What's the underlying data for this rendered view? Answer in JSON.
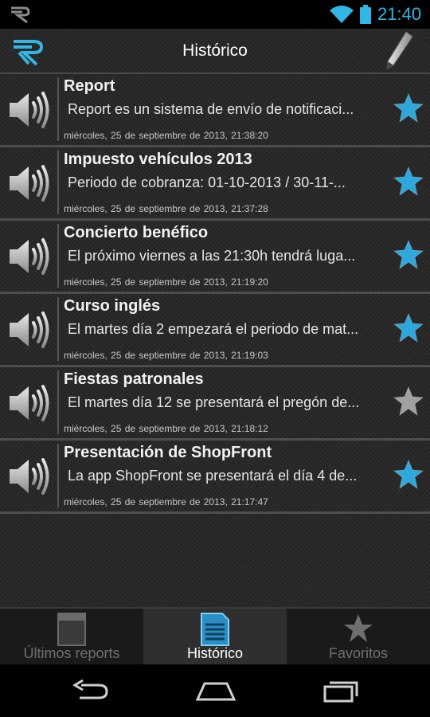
{
  "status_bar": {
    "time": "21:40"
  },
  "action_bar": {
    "title": "Histórico"
  },
  "colors": {
    "accent": "#33b5e5",
    "star_favorite": "#2ea7dd",
    "star_plain": "#a0a0a0"
  },
  "items": [
    {
      "title": "Report",
      "body": "Report es un sistema de envío de notificaci...",
      "date": "miércoles,  25 de septiembre de 2013, 21:38:20",
      "favorite": true
    },
    {
      "title": "Impuesto vehículos 2013",
      "body": "Periodo de cobranza:  01-10-2013 / 30-11-...",
      "date": "miércoles,  25 de septiembre de 2013, 21:37:28",
      "favorite": true
    },
    {
      "title": "Concierto benéfico",
      "body": "El próximo viernes a las 21:30h tendrá luga...",
      "date": "miércoles,  25 de septiembre de 2013, 21:19:20",
      "favorite": true
    },
    {
      "title": "Curso inglés",
      "body": "El martes día 2 empezará el periodo de mat...",
      "date": "miércoles,  25 de septiembre de 2013, 21:19:03",
      "favorite": true
    },
    {
      "title": "Fiestas patronales",
      "body": "El martes día 12 se presentará el pregón de...",
      "date": "miércoles,  25 de septiembre de 2013, 21:18:12",
      "favorite": false
    },
    {
      "title": "Presentación de ShopFront",
      "body": "La app ShopFront se presentará el día 4 de...",
      "date": "miércoles,  25 de septiembre de 2013, 21:17:47",
      "favorite": true
    }
  ],
  "tabs": [
    {
      "label": "Últimos reports",
      "icon": "newspaper-icon",
      "active": false
    },
    {
      "label": "Histórico",
      "icon": "document-list-icon",
      "active": true
    },
    {
      "label": "Favoritos",
      "icon": "star-icon",
      "active": false
    }
  ],
  "nav_bar": {
    "icons": [
      "back-icon",
      "home-icon",
      "recent-apps-icon"
    ]
  }
}
